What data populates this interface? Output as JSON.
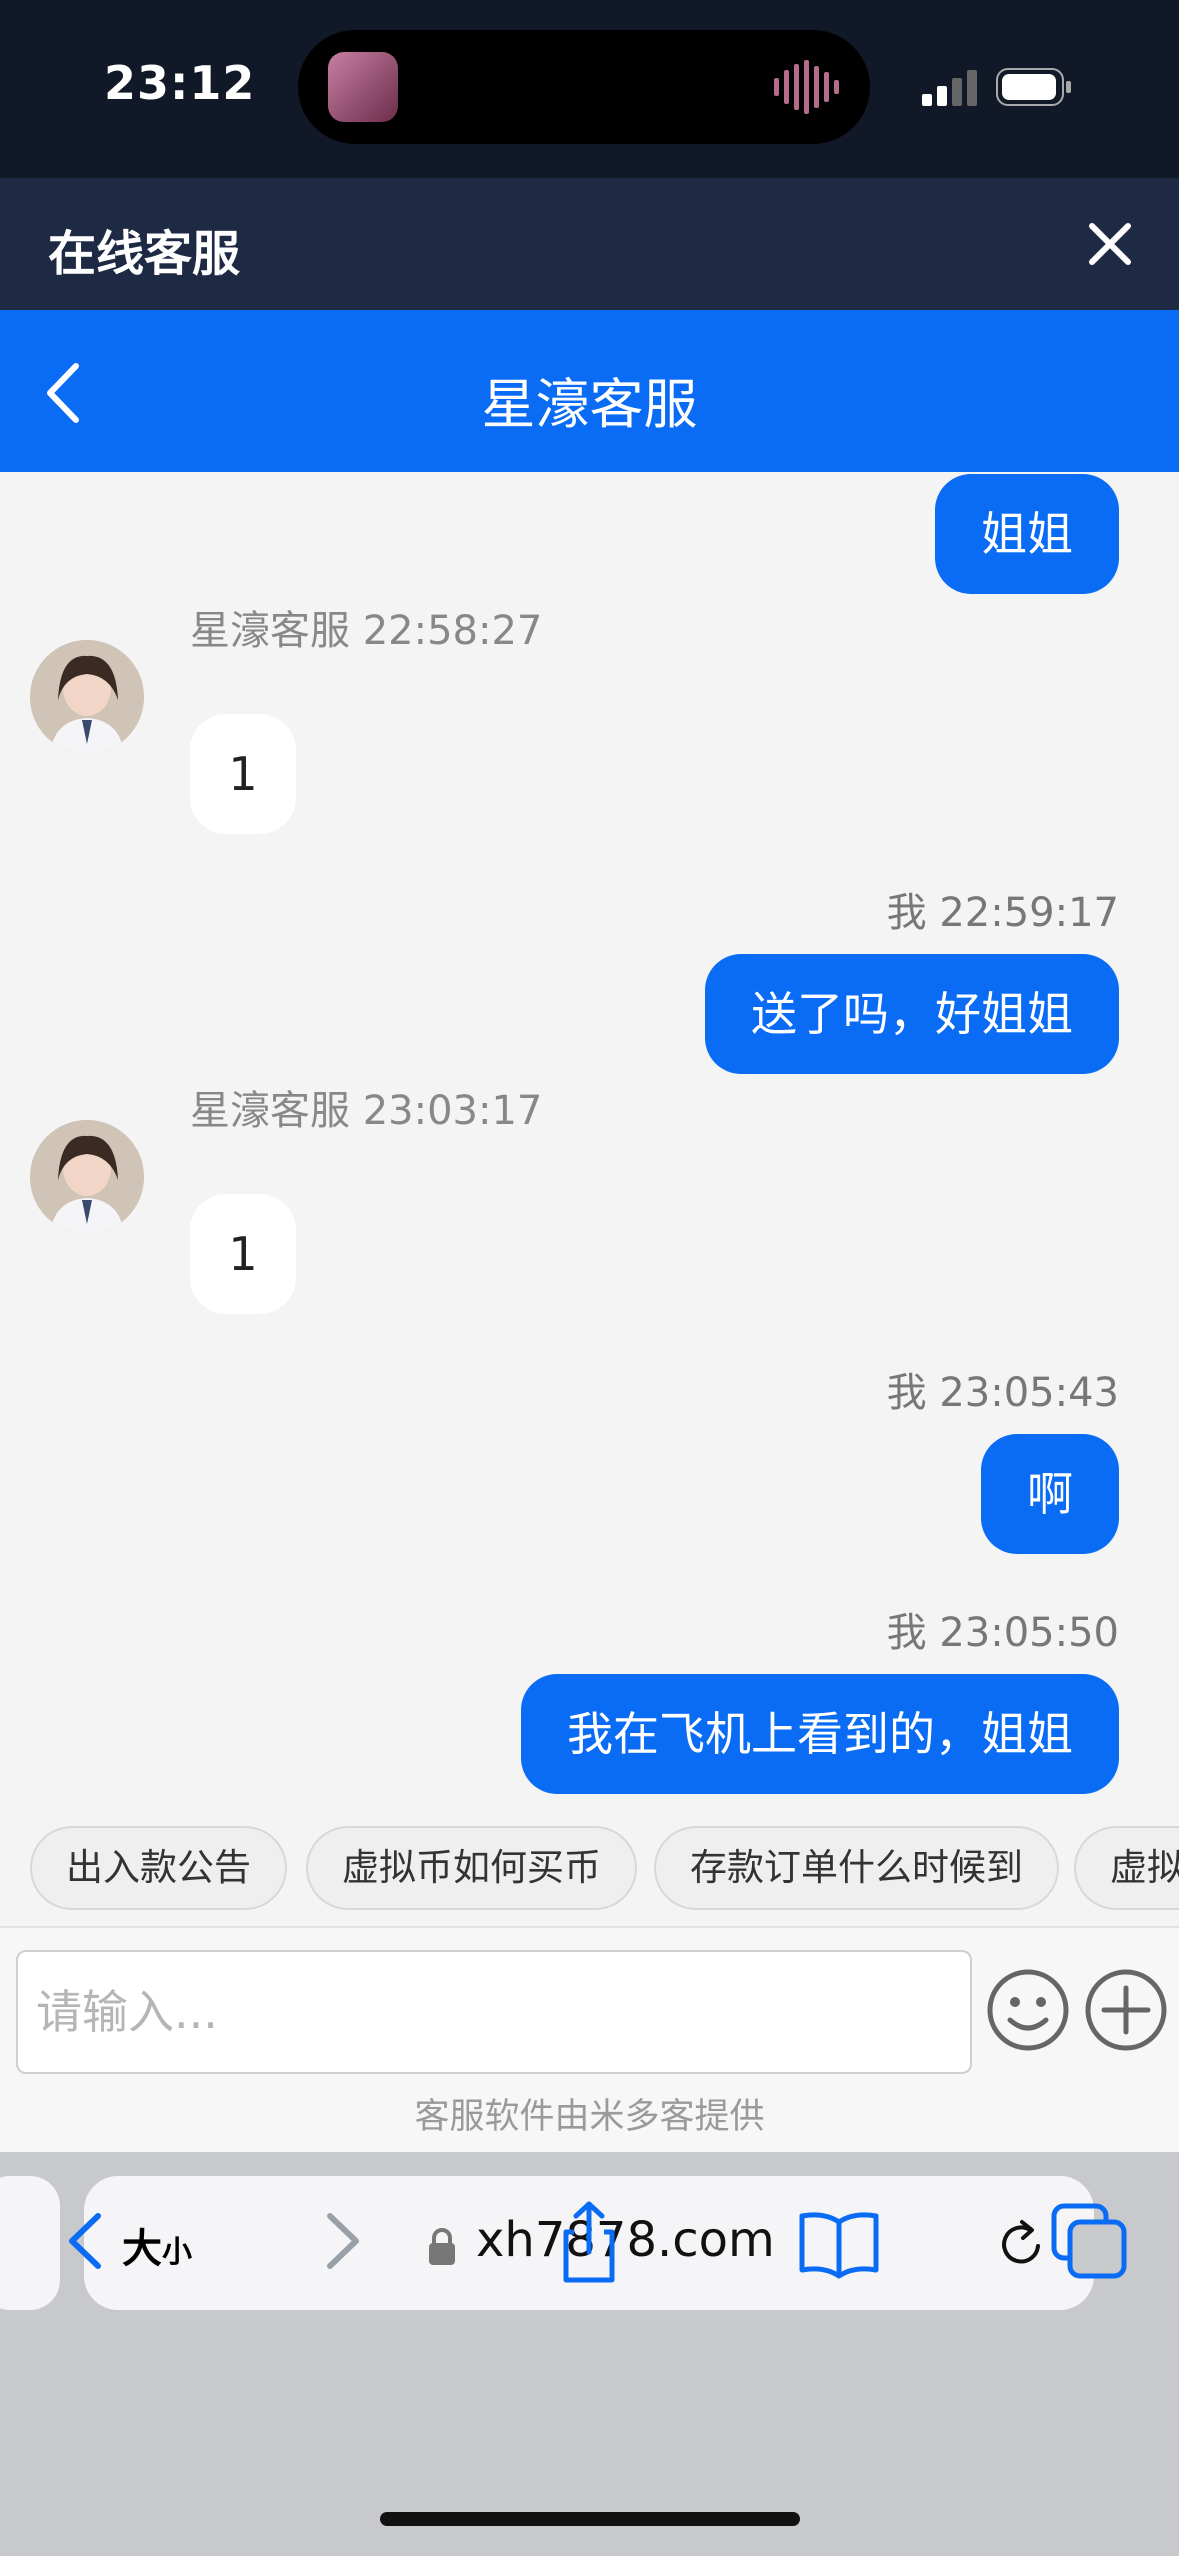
{
  "status_bar": {
    "time": "23:12"
  },
  "header": {
    "title": "在线客服"
  },
  "nav": {
    "title": "星濠客服"
  },
  "messages": [
    {
      "from": "me",
      "text": "姐姐"
    },
    {
      "from": "them",
      "meta": "星濠客服 22:58:27",
      "text": "1"
    },
    {
      "from": "me",
      "meta": "我 22:59:17",
      "text": "送了吗，好姐姐"
    },
    {
      "from": "them",
      "meta": "星濠客服 23:03:17",
      "text": "1"
    },
    {
      "from": "me",
      "meta": "我 23:05:43",
      "text": "啊"
    },
    {
      "from": "me",
      "meta": "我 23:05:50",
      "text": "我在飞机上看到的，姐姐"
    }
  ],
  "quick_replies": [
    "出入款公告",
    "虚拟币如何买币",
    "存款订单什么时候到",
    "虚拟"
  ],
  "input": {
    "placeholder": "请输入..."
  },
  "powered_by": "客服软件由米多客提供",
  "browser": {
    "text_size_label": "大",
    "text_size_small": "小",
    "url": "xh7878.com"
  },
  "colors": {
    "accent": "#0a6cf5",
    "header_dark": "#1e2a44"
  }
}
